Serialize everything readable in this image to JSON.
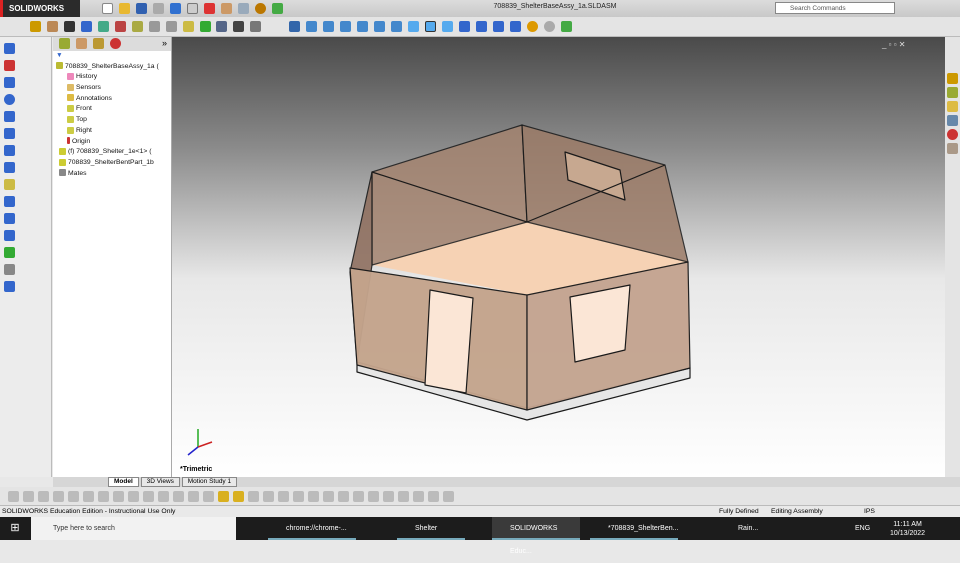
{
  "app": {
    "logo": "SOLIDWORKS",
    "title": "708839_ShelterBaseAssy_1a.SLDASM",
    "search_placeholder": "Search Commands"
  },
  "tree": {
    "root": "708839_ShelterBaseAssy_1a (",
    "items": [
      "History",
      "Sensors",
      "Annotations",
      "Front",
      "Top",
      "Right",
      "Origin",
      "(f) 708839_Shelter_1e<1> (",
      "708839_ShelterBentPart_1b",
      "Mates"
    ]
  },
  "view": {
    "orientation": "*Trimetric"
  },
  "tabs": [
    "Model",
    "3D Views",
    "Motion Study 1"
  ],
  "status": {
    "edition": "SOLIDWORKS Education Edition - Instructional Use Only",
    "state": "Fully Defined",
    "mode": "Editing Assembly",
    "units": "IPS"
  },
  "taskbar": {
    "search": "Type here to search",
    "apps": [
      "chrome://chrome-...",
      "Shelter",
      "SOLIDWORKS Educ...",
      "*708839_ShelterBen..."
    ],
    "weather": "Rain...",
    "lang": "ENG",
    "time": "11:11 AM",
    "date": "10/13/2022"
  }
}
